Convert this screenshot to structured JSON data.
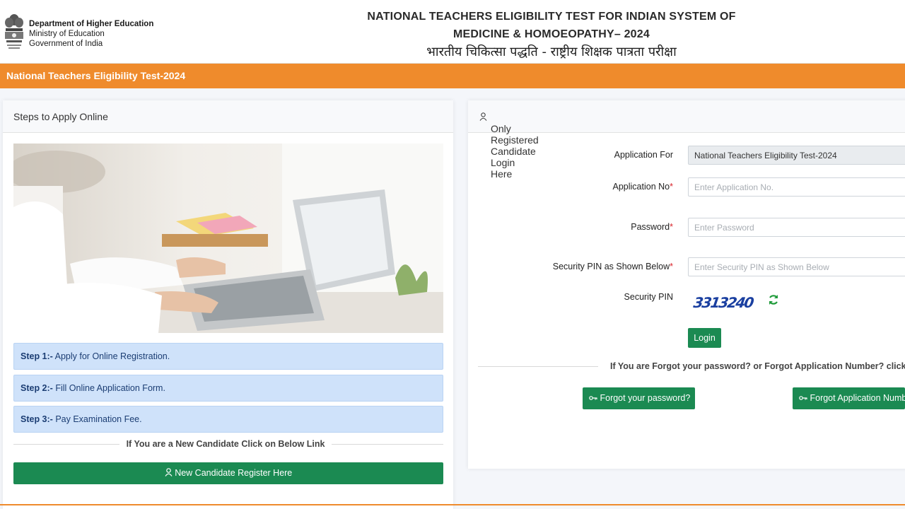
{
  "header": {
    "dept_name": "Department of Higher Education",
    "ministry": "Ministry of Education",
    "government": "Government of India",
    "title_line1": "NATIONAL TEACHERS ELIGIBILITY TEST FOR INDIAN SYSTEM OF",
    "title_line2": "MEDICINE & HOMOEOPATHY– 2024",
    "title_hindi": "भारतीय चिकित्सा पद्धति - राष्ट्रीय शिक्षक पात्रता परीक्षा",
    "emblem_icon": "national-emblem-icon"
  },
  "banner": {
    "label": "National Teachers Eligibility Test-2024",
    "color": "#ef8b2c"
  },
  "steps_panel": {
    "heading": "Steps to Apply Online",
    "steps": [
      {
        "label": "Step 1:-",
        "text": "Apply for Online Registration."
      },
      {
        "label": "Step 2:-",
        "text": "Fill Online Application Form."
      },
      {
        "label": "Step 3:-",
        "text": "Pay Examination Fee."
      }
    ],
    "new_candidate_text": "If You are a New Candidate Click on Below Link",
    "register_button": "New Candidate Register Here"
  },
  "login_panel": {
    "heading": "Only Registered Candidate Login Here",
    "fields": {
      "application_for": {
        "label": "Application For",
        "value": "National Teachers Eligibility Test-2024"
      },
      "application_no": {
        "label": "Application No",
        "placeholder": "Enter Application No."
      },
      "password": {
        "label": "Password",
        "placeholder": "Enter Password"
      },
      "security_pin": {
        "label": "Security PIN as Shown Below",
        "placeholder": "Enter Security PIN as Shown Below"
      },
      "captcha": {
        "label": "Security PIN",
        "value": "3313240"
      }
    },
    "required_mark": "*",
    "login_button": "Login",
    "forgot_text": "If You are Forgot your password? or Forgot Application Number? click",
    "forgot_password_button": "Forgot your password?",
    "forgot_appno_button": "Forgot Application Number"
  },
  "colors": {
    "accent_green": "#1b8a52",
    "step_bg": "#cfe2fa",
    "orange": "#ef8b2c"
  }
}
